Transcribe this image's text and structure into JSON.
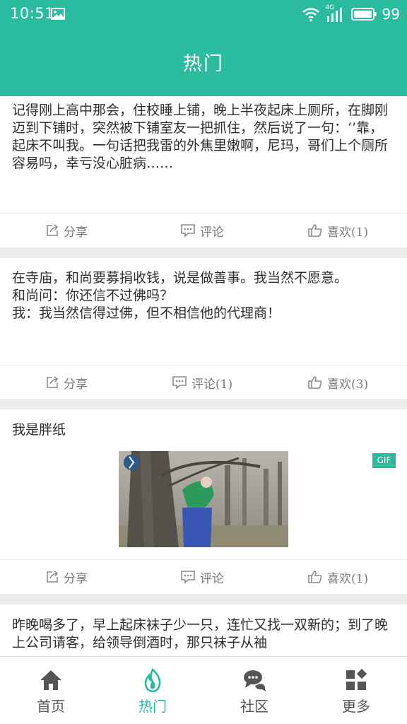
{
  "status_bar": {
    "time": "10:51",
    "network": "4G",
    "battery": "99",
    "icons": [
      "image-icon",
      "wifi-icon",
      "signal-icon",
      "battery-icon"
    ]
  },
  "header": {
    "title": "热门"
  },
  "theme": {
    "accent": "#2bbb9f",
    "action_gray": "#7a7a7a"
  },
  "posts": [
    {
      "text": "记得刚上高中那会，住校睡上铺，晚上半夜起床上厕所，在脚刚迈到下铺时，突然被下铺室友一把抓住，然后说了一句：‘’靠，起床不叫我。一句话把我雷的外焦里嫩啊，尼玛，哥们上个厕所容易吗，幸亏没心脏病……",
      "share": "分享",
      "comment": "评论",
      "like": "喜欢(1)"
    },
    {
      "text": "在寺庙，和尚要募捐收钱，说是做善事。我当然不愿意。\n和尚问：你还信不过佛吗？\n我：我当然信得过佛，但不相信他的代理商！",
      "share": "分享",
      "comment": "评论(1)",
      "like": "喜欢(3)"
    },
    {
      "text": "我是胖纸",
      "badge": "GIF",
      "share": "分享",
      "comment": "评论",
      "like": "喜欢(1)"
    },
    {
      "text": "昨晚喝多了，早上起床袜子少一只，连忙又找一双新的；到了晚上公司请客，给领导倒酒时，那只袜子从袖"
    }
  ],
  "bottom_nav": [
    {
      "label": "首页",
      "icon": "home-icon"
    },
    {
      "label": "热门",
      "icon": "flame-icon",
      "active": true
    },
    {
      "label": "社区",
      "icon": "chat-bubbles-icon"
    },
    {
      "label": "更多",
      "icon": "grid-icon"
    }
  ]
}
